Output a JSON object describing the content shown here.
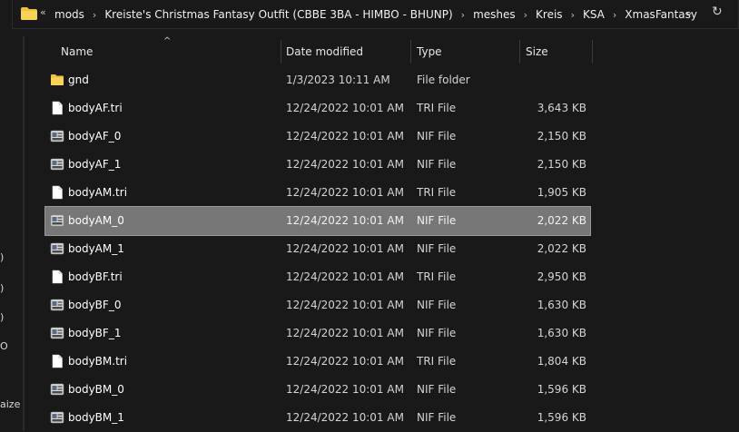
{
  "address": {
    "crumbs": [
      "mods",
      "Kreiste's Christmas Fantasy Outfit (CBBE 3BA - HIMBO - BHUNP)",
      "meshes",
      "Kreis",
      "KSA",
      "XmasFantasy"
    ]
  },
  "columns": {
    "name": "Name",
    "date": "Date modified",
    "type": "Type",
    "size": "Size"
  },
  "nav_fragments": [
    ")",
    ")",
    ")",
    "O",
    "aize"
  ],
  "files": [
    {
      "name": "gnd",
      "date": "1/3/2023 10:11 AM",
      "type": "File folder",
      "size": "",
      "icon": "folder-icon",
      "selected": false
    },
    {
      "name": "bodyAF.tri",
      "date": "12/24/2022 10:01 AM",
      "type": "TRI File",
      "size": "3,643 KB",
      "icon": "document-icon",
      "selected": false
    },
    {
      "name": "bodyAF_0",
      "date": "12/24/2022 10:01 AM",
      "type": "NIF File",
      "size": "2,150 KB",
      "icon": "nif-file-icon",
      "selected": false
    },
    {
      "name": "bodyAF_1",
      "date": "12/24/2022 10:01 AM",
      "type": "NIF File",
      "size": "2,150 KB",
      "icon": "nif-file-icon",
      "selected": false
    },
    {
      "name": "bodyAM.tri",
      "date": "12/24/2022 10:01 AM",
      "type": "TRI File",
      "size": "1,905 KB",
      "icon": "document-icon",
      "selected": false
    },
    {
      "name": "bodyAM_0",
      "date": "12/24/2022 10:01 AM",
      "type": "NIF File",
      "size": "2,022 KB",
      "icon": "nif-file-icon",
      "selected": true
    },
    {
      "name": "bodyAM_1",
      "date": "12/24/2022 10:01 AM",
      "type": "NIF File",
      "size": "2,022 KB",
      "icon": "nif-file-icon",
      "selected": false
    },
    {
      "name": "bodyBF.tri",
      "date": "12/24/2022 10:01 AM",
      "type": "TRI File",
      "size": "2,950 KB",
      "icon": "document-icon",
      "selected": false
    },
    {
      "name": "bodyBF_0",
      "date": "12/24/2022 10:01 AM",
      "type": "NIF File",
      "size": "1,630 KB",
      "icon": "nif-file-icon",
      "selected": false
    },
    {
      "name": "bodyBF_1",
      "date": "12/24/2022 10:01 AM",
      "type": "NIF File",
      "size": "1,630 KB",
      "icon": "nif-file-icon",
      "selected": false
    },
    {
      "name": "bodyBM.tri",
      "date": "12/24/2022 10:01 AM",
      "type": "TRI File",
      "size": "1,804 KB",
      "icon": "document-icon",
      "selected": false
    },
    {
      "name": "bodyBM_0",
      "date": "12/24/2022 10:01 AM",
      "type": "NIF File",
      "size": "1,596 KB",
      "icon": "nif-file-icon",
      "selected": false
    },
    {
      "name": "bodyBM_1",
      "date": "12/24/2022 10:01 AM",
      "type": "NIF File",
      "size": "1,596 KB",
      "icon": "nif-file-icon",
      "selected": false
    }
  ],
  "colors": {
    "background": "#191919",
    "selected_row": "#777777",
    "folder": "#f0c040"
  }
}
